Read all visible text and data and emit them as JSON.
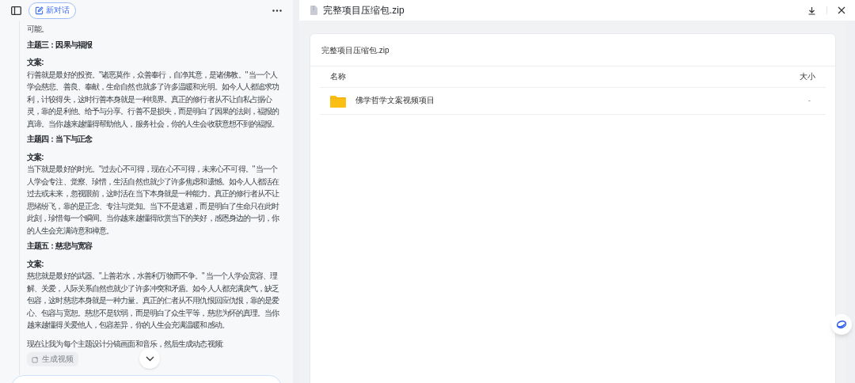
{
  "chat": {
    "new_chat": "新对话",
    "blocks": [
      {
        "kind": "text",
        "text": "可能。"
      },
      {
        "kind": "heading",
        "text": "主题三：因果与福报"
      },
      {
        "kind": "label",
        "text": "文案:"
      },
      {
        "kind": "text",
        "text": "行善就是最好的投资。\"诸恶莫作，众善奉行，自净其意，是诸佛教。\" 当一个人学会慈悲、善良、奉献，生命自然也就多了许多温暖和光明。如今人人都追求功利，计较得失，这时行善本身就是一种境界。真正的修行者从不让自私占据心灵，靠的是利他、给予与分享。行善不是损失，而是明白了因果的法则，福报的真谛。当你越来越懂得帮助他人，服务社会，你的人生会收获意想不到的福报。"
      },
      {
        "kind": "heading",
        "text": "主题四：当下与正念"
      },
      {
        "kind": "label",
        "text": "文案:"
      },
      {
        "kind": "text",
        "text": "当下就是最好的时光。\"过去心不可得，现在心不可得，未来心不可得。\" 当一个人学会专注、觉察、珍惜，生活自然也就少了许多焦虑和遗憾。如今人人都活在过去或未来，忽视眼前，这时活在当下本身就是一种能力。真正的修行者从不让思绪纷飞，靠的是正念、专注与觉知。当下不是逃避，而是明白了生命只在此时此刻，珍惜每一个瞬间。当你越来越懂得欣赏当下的美好，感恩身边的一切，你的人生会充满诗意和禅意。"
      },
      {
        "kind": "heading",
        "text": "主题五：慈悲与宽容"
      },
      {
        "kind": "label",
        "text": "文案:"
      },
      {
        "kind": "text",
        "text": "慈悲就是最好的武器。\"上善若水，水善利万物而不争。\" 当一个人学会宽容、理解、关爱，人际关系自然也就少了许多冲突和矛盾。如今人人都充满戾气，缺乏包容，这时慈悲本身就是一种力量。真正的仁者从不用仇恨回应仇恨，靠的是爱心、包容与宽恕。慈悲不是软弱，而是明白了众生平等，慈悲为怀的真理。当你越来越懂得关爱他人，包容差异，你的人生会充满温暖和感动。"
      },
      {
        "kind": "closing",
        "text": "现在让我为每个主题设计分镜画面和音乐，然后生成动态视频:"
      }
    ],
    "action": "生成视频"
  },
  "preview": {
    "title": "完整项目压缩包.zip",
    "card_title": "完整项目压缩包.zip",
    "columns": [
      "名称",
      "大小"
    ],
    "rows": [
      {
        "kind": "folder",
        "name": "佛学哲学文案视频项目",
        "size": "-"
      }
    ]
  }
}
